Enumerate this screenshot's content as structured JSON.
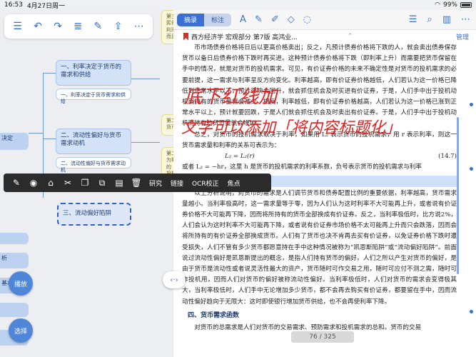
{
  "status": {
    "time": "16:53",
    "date": "4月27日周一",
    "battery": "99%"
  },
  "mindmap": {
    "nodes": [
      {
        "label": "一、利率决定于货币的需求和供给"
      },
      {
        "label": "一、利率决定于货币需求和供给"
      },
      {
        "label": "二、流动性偏好与货币需求动机"
      },
      {
        "label": "二、流动性偏好与货币需求动机"
      },
      {
        "label": "三、流动偏好陷阱"
      }
    ],
    "left_labels": [
      "决定",
      "析",
      "基本"
    ],
    "yellow_notes": [
      "第三\n民依\n利率\n而且",
      "第二\n货币",
      "第二\n为利\n的\n投机"
    ],
    "buttons": {
      "play": "播放",
      "select": "选择"
    }
  },
  "context_menu": {
    "icons": [
      "edit-icon",
      "palette-icon",
      "tag-icon",
      "scissors-icon",
      "copy-icon",
      "duplicate-icon",
      "paste-icon",
      "delete-icon"
    ],
    "actions": [
      "研究",
      "链接",
      "OCR校正",
      "焦点"
    ]
  },
  "reader": {
    "tabs": [
      "摘录",
      "标注"
    ],
    "doc_title": "西方经济学 宏观部分 第7版 高鸿业...",
    "manage": "管理",
    "page_indicator": "76 / 325",
    "paragraphs": [
      "币市场债券价格将日后以更高价格卖出；反之，凡预计债券价格将下跌的人，就会卖出债券保存货币以备日后债券价格下跌时再买进。这种预计债券价格将下跌（即利率上升）而需要把货币保留在手中的情况，就是对货币的投机需求。可见，有价证券价格的未来不确定性是对货币的投机需求的必要前提，这一需求与利率呈反方向变化。利率越高，即有价证券价格越低，人们若认为这一价格已降低到正常水平以下，预计很快会回升，就会抓住机会及时买进有价证券，于是，人们手中出于投机动机而持有的货币量就会减少。相反，利率越低，即有价证券价格越高，人们若认为这一价格已涨到正常水平以上，预计就要回跌，于是人们就会抓住机会及时卖出有价证券。于是，人们手中出于投机动机而持有的货币量就会增加。",
      "总之，对货币的投机需求取决于利率，如果用 L₂ 表示货币的投机需求，用 r 表示利率，则这一货币需求量和利率的关系可表示为："
    ],
    "equation": {
      "expr": "L₂ = L₂(r)",
      "number": "(14.7)"
    },
    "after_eq": "或者 L₂ = −hr，这里 h 是货币的投机需求的利率系数，负号表示货币的投机需求与利率",
    "section3": "三、流动偏好陷阱",
    "section3_text": "以上分析说明，对货币的需求是人们调节货币和债券配置比例的重要依据，利率越高，货币需求量越小。当利率极高时，这一需求量等于零，因为人们认为这时利率不大可能再上升，或者说有价证券价格不大可能再下降，因而将所持有的货币全部换成有价证券。反之，当利率极低时，比方说2%，人们会认为这时利率不大可能再下降，或者说有价证券市场价格不太可能再上升而只会跌落，因而会将所持有的有价证券全部换成货币。人们有了货币也决不肯再去买有价证券，以免证券价格下跌时遭受损失，人们不管有多少货币都愿意持在手中这种情况被称为“凯恩斯陷阱”或“流动偏好陷阱”。前面说过流动性偏好是凯恩斯提出的概念，是指人们持有货币的偏好。人们之所以产生对货币的偏好，是由于货币是流动性或者说灵活性最大的资产，货币随时可作交易之用，随时可应付不测之需，随时可作投机用，因而人们对货币的偏好被称流动性偏好。当利率极低时，人们对货币的需求会变得极其大，当利率极低时，人们手中无论增加多少货币，都不会再去购买有价证券，都要留在手中，因而流动性偏好趋向于无限大：这时即使银行增加货币供给，也不会再使利率下降。",
    "section4": "四、货币需求函数",
    "section4_text": "对货币的总需求是人们对货币的交易需求、预防需求和投机需求的总和。货币的交易"
  },
  "annotation": {
    "line1": "底下红线加",
    "line2": "文字可以添加「将内容标题化」"
  }
}
